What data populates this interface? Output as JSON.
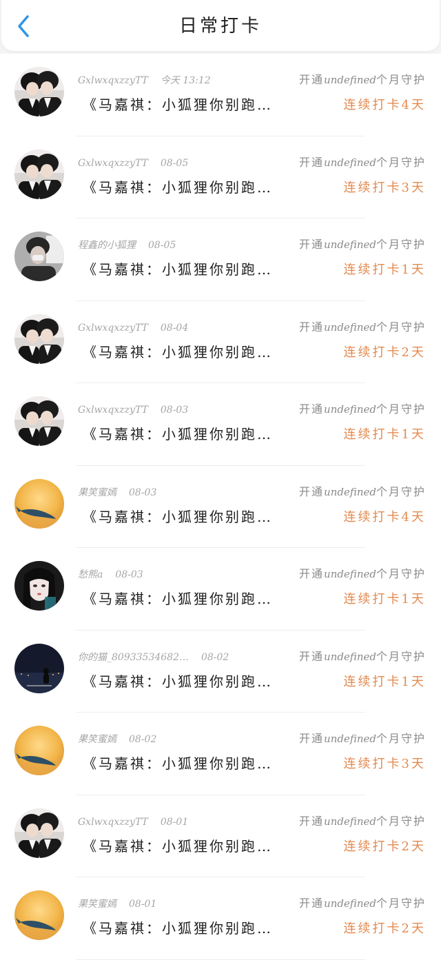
{
  "header": {
    "title": "日常打卡",
    "back_icon": "chevron-left-icon",
    "accent": "#2f95e8"
  },
  "colors": {
    "streak": "#e38a4f",
    "meta": "#a6a6a6"
  },
  "items": [
    {
      "user": "GxlwxqxzzyTT",
      "date": "今天 13:12",
      "content": "《马嘉祺：小狐狸你别跑…",
      "guard_prefix": "开通",
      "guard_mid": "undefined",
      "guard_suffix": "个月守护",
      "streak": "连续打卡4天",
      "avatar": "avatar-couple"
    },
    {
      "user": "GxlwxqxzzyTT",
      "date": "08-05",
      "content": "《马嘉祺：小狐狸你别跑…",
      "guard_prefix": "开通",
      "guard_mid": "undefined",
      "guard_suffix": "个月守护",
      "streak": "连续打卡3天",
      "avatar": "avatar-couple"
    },
    {
      "user": "程鑫的小狐狸",
      "date": "08-05",
      "content": "《马嘉祺：小狐狸你别跑…",
      "guard_prefix": "开通",
      "guard_mid": "undefined",
      "guard_suffix": "个月守护",
      "streak": "连续打卡1天",
      "avatar": "avatar-boy"
    },
    {
      "user": "GxlwxqxzzyTT",
      "date": "08-04",
      "content": "《马嘉祺：小狐狸你别跑…",
      "guard_prefix": "开通",
      "guard_mid": "undefined",
      "guard_suffix": "个月守护",
      "streak": "连续打卡2天",
      "avatar": "avatar-couple"
    },
    {
      "user": "GxlwxqxzzyTT",
      "date": "08-03",
      "content": "《马嘉祺：小狐狸你别跑…",
      "guard_prefix": "开通",
      "guard_mid": "undefined",
      "guard_suffix": "个月守护",
      "streak": "连续打卡1天",
      "avatar": "avatar-couple"
    },
    {
      "user": "果笑蜜嫣",
      "date": "08-03",
      "content": "《马嘉祺：小狐狸你别跑…",
      "guard_prefix": "开通",
      "guard_mid": "undefined",
      "guard_suffix": "个月守护",
      "streak": "连续打卡4天",
      "avatar": "avatar-whale"
    },
    {
      "user": "愁熊a",
      "date": "08-03",
      "content": "《马嘉祺：小狐狸你别跑…",
      "guard_prefix": "开通",
      "guard_mid": "undefined",
      "guard_suffix": "个月守护",
      "streak": "连续打卡1天",
      "avatar": "avatar-girl"
    },
    {
      "user": "你的猫_80933534682…",
      "date": "08-02",
      "content": "《马嘉祺：小狐狸你别跑…",
      "guard_prefix": "开通",
      "guard_mid": "undefined",
      "guard_suffix": "个月守护",
      "streak": "连续打卡1天",
      "avatar": "avatar-night"
    },
    {
      "user": "果笑蜜嫣",
      "date": "08-02",
      "content": "《马嘉祺：小狐狸你别跑…",
      "guard_prefix": "开通",
      "guard_mid": "undefined",
      "guard_suffix": "个月守护",
      "streak": "连续打卡3天",
      "avatar": "avatar-whale"
    },
    {
      "user": "GxlwxqxzzyTT",
      "date": "08-01",
      "content": "《马嘉祺：小狐狸你别跑…",
      "guard_prefix": "开通",
      "guard_mid": "undefined",
      "guard_suffix": "个月守护",
      "streak": "连续打卡2天",
      "avatar": "avatar-couple"
    },
    {
      "user": "果笑蜜嫣",
      "date": "08-01",
      "content": "《马嘉祺：小狐狸你别跑…",
      "guard_prefix": "开通",
      "guard_mid": "undefined",
      "guard_suffix": "个月守护",
      "streak": "连续打卡2天",
      "avatar": "avatar-whale"
    }
  ]
}
